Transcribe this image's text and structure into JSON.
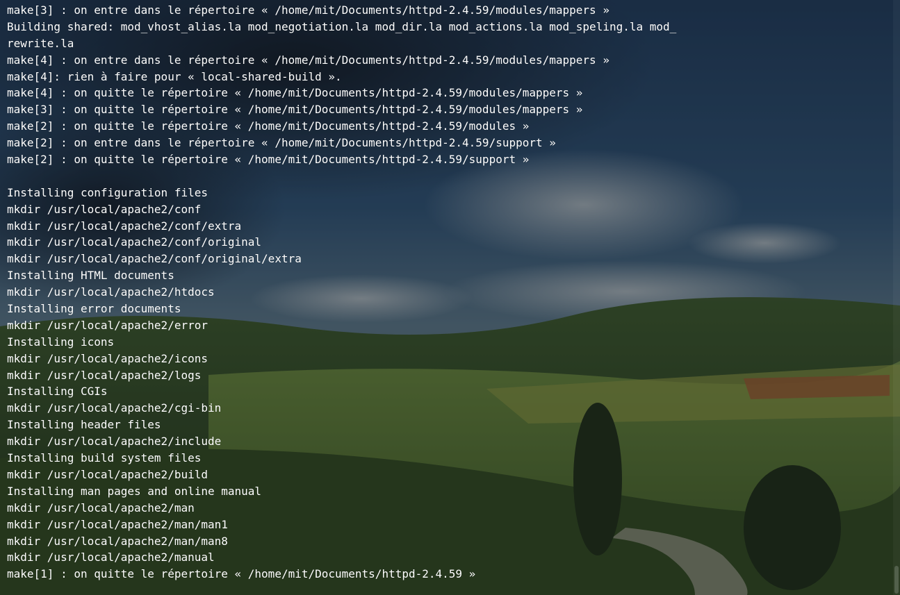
{
  "window": {
    "type": "terminal",
    "background": "landscape-wallpaper",
    "text_color": "#ffffff"
  },
  "terminal": {
    "lines": [
      "make[3] : on entre dans le répertoire « /home/mit/Documents/httpd-2.4.59/modules/mappers »",
      "Building shared: mod_vhost_alias.la mod_negotiation.la mod_dir.la mod_actions.la mod_speling.la mod_",
      "rewrite.la",
      "make[4] : on entre dans le répertoire « /home/mit/Documents/httpd-2.4.59/modules/mappers »",
      "make[4]: rien à faire pour « local-shared-build ».",
      "make[4] : on quitte le répertoire « /home/mit/Documents/httpd-2.4.59/modules/mappers »",
      "make[3] : on quitte le répertoire « /home/mit/Documents/httpd-2.4.59/modules/mappers »",
      "make[2] : on quitte le répertoire « /home/mit/Documents/httpd-2.4.59/modules »",
      "make[2] : on entre dans le répertoire « /home/mit/Documents/httpd-2.4.59/support »",
      "make[2] : on quitte le répertoire « /home/mit/Documents/httpd-2.4.59/support »",
      "",
      "Installing configuration files",
      "mkdir /usr/local/apache2/conf",
      "mkdir /usr/local/apache2/conf/extra",
      "mkdir /usr/local/apache2/conf/original",
      "mkdir /usr/local/apache2/conf/original/extra",
      "Installing HTML documents",
      "mkdir /usr/local/apache2/htdocs",
      "Installing error documents",
      "mkdir /usr/local/apache2/error",
      "Installing icons",
      "mkdir /usr/local/apache2/icons",
      "mkdir /usr/local/apache2/logs",
      "Installing CGIs",
      "mkdir /usr/local/apache2/cgi-bin",
      "Installing header files",
      "mkdir /usr/local/apache2/include",
      "Installing build system files",
      "mkdir /usr/local/apache2/build",
      "Installing man pages and online manual",
      "mkdir /usr/local/apache2/man",
      "mkdir /usr/local/apache2/man/man1",
      "mkdir /usr/local/apache2/man/man8",
      "mkdir /usr/local/apache2/manual",
      "make[1] : on quitte le répertoire « /home/mit/Documents/httpd-2.4.59 »"
    ]
  }
}
